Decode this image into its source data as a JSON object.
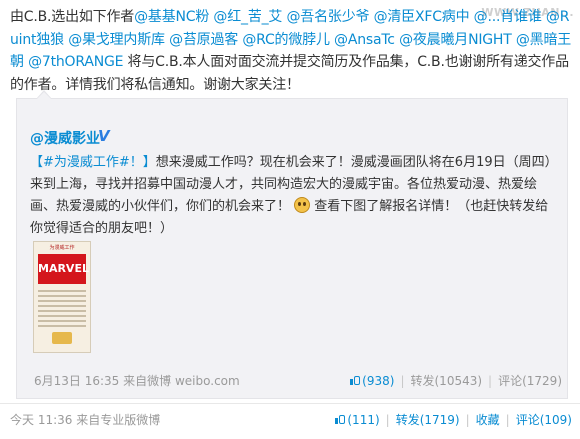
{
  "watermark": "WWW.ZHAN...",
  "post": {
    "intro": "由C.B.选出如下作者",
    "mentions": [
      "@基基NC粉",
      "@红_苦_艾",
      "@吾名张少爷",
      "@清臣XFC病中",
      "@...",
      "肖谁谁",
      "@Ruint独狼",
      "@果戈理内斯库",
      "@苔原過客",
      "@RC的微脖儿",
      "@AnsaTc",
      "@夜晨曦月NIGHT",
      "@黑暗王朝",
      "@7thORANGE"
    ],
    "body": "将与C.B.本人面对面交流并提交简历及作品集，C.B.也谢谢所有递交作品的作者。详情我们将私信通知。谢谢大家关注！",
    "time": "今天 11:36",
    "from_label": "来自",
    "source": "专业版微博",
    "likes": "(111)",
    "repost": "转发(1719)",
    "favorite": "收藏",
    "comment": "评论(109)"
  },
  "quote": {
    "author": "@漫威影业",
    "verified": "V",
    "hashtag": "【#为漫威工作#！】",
    "text1": "想来漫威工作吗？现在机会来了！漫威漫画团队将在6月19日（周四）来到上海，寻找并招募中国动漫人才，共同构造宏大的漫威宇宙。各位热爱动漫、热爱绘画、热爱漫威的小伙伴们，你们的机会来了！",
    "emoji": "emoji-face",
    "text2": "查看下图了解报名详情！（也赶快转发给你觉得适合的朋友吧！）",
    "thumb_header": "为漫威工作",
    "thumb_logo": "MARVEL",
    "time": "6月13日 16:35",
    "from_label": "来自",
    "source": "微博 weibo.com",
    "likes": "(938)",
    "repost": "转发(10543)",
    "comment": "评论(1729)"
  }
}
